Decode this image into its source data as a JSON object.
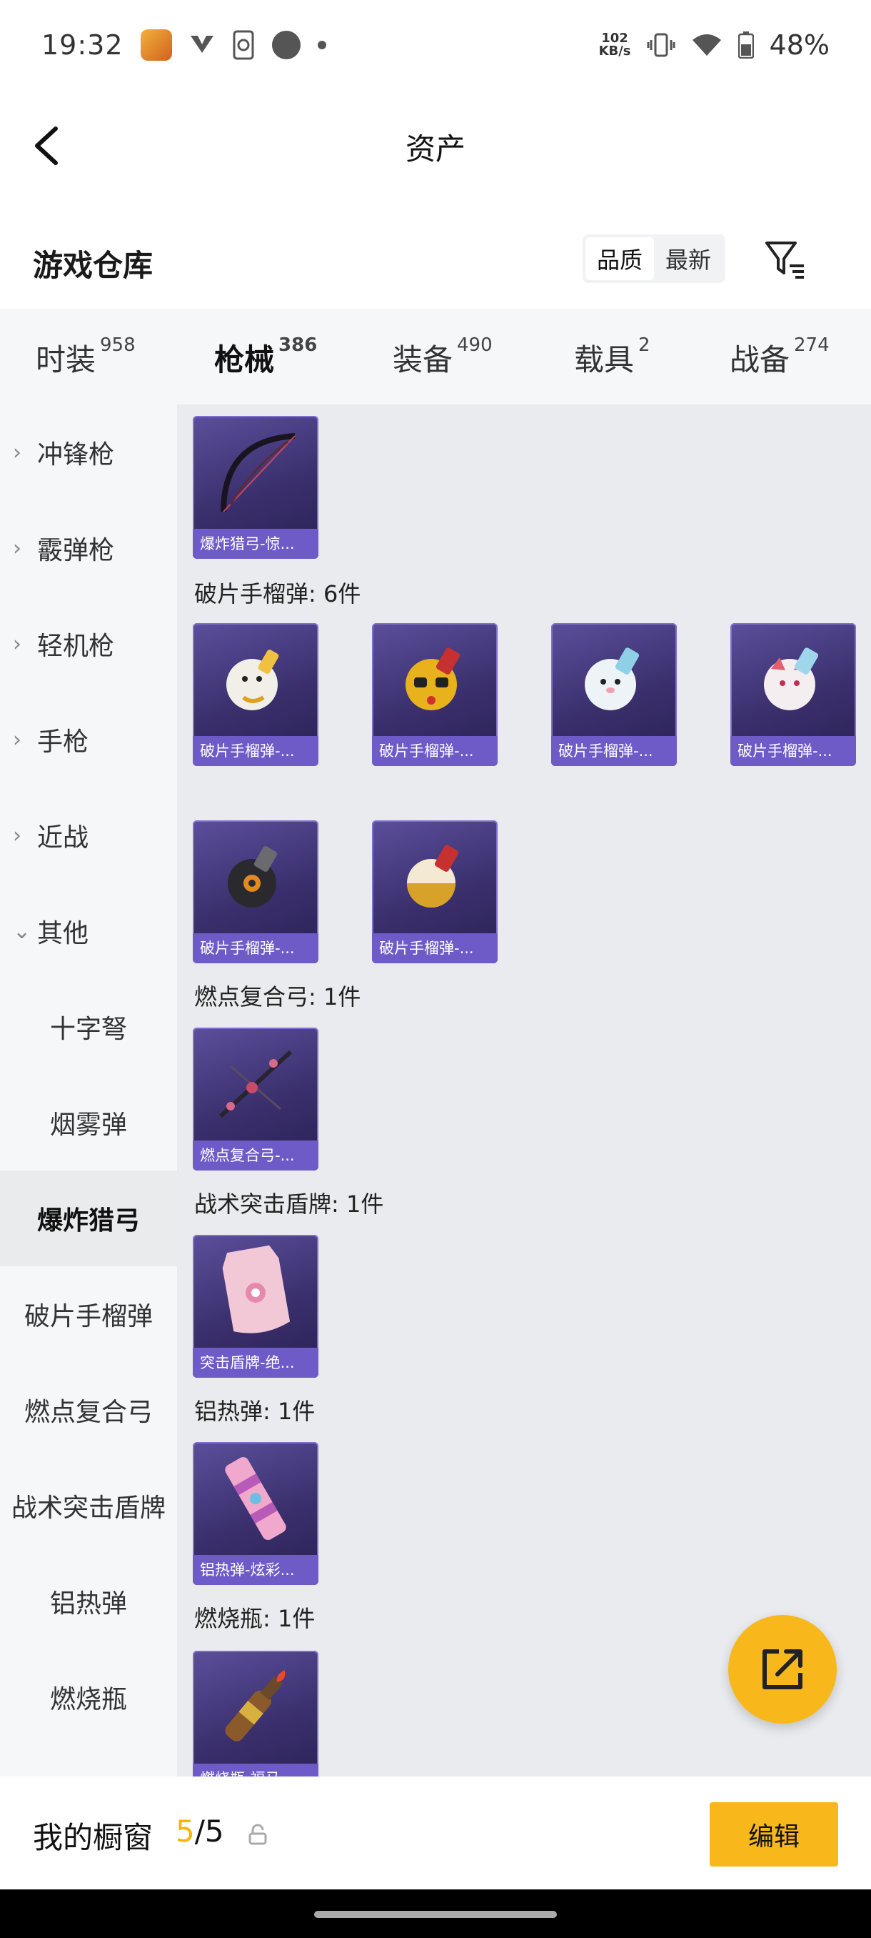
{
  "status_bar": {
    "time": "19:32",
    "net_speed_value": "102",
    "net_speed_unit": "KB/s",
    "battery": "48%",
    "icons": [
      "app-icon",
      "logo-icon",
      "sync-icon",
      "record-dot-icon",
      "dot-icon",
      "vibrate-icon",
      "wifi-icon",
      "battery-icon"
    ]
  },
  "header": {
    "title": "资产"
  },
  "warehouse": {
    "title": "游戏仓库",
    "sort_options": [
      "品质",
      "最新"
    ],
    "sort_active_index": 0
  },
  "tabs": [
    {
      "label": "时装",
      "count": "958"
    },
    {
      "label": "枪械",
      "count": "386",
      "active": true
    },
    {
      "label": "装备",
      "count": "490"
    },
    {
      "label": "载具",
      "count": "2"
    },
    {
      "label": "战备",
      "count": "274"
    }
  ],
  "sidebar": [
    {
      "label": "冲锋枪",
      "expandable": true
    },
    {
      "label": "霰弹枪",
      "expandable": true
    },
    {
      "label": "轻机枪",
      "expandable": true
    },
    {
      "label": "手枪",
      "expandable": true
    },
    {
      "label": "近战",
      "expandable": true
    },
    {
      "label": "其他",
      "expanded": true
    },
    {
      "label": "十字弩"
    },
    {
      "label": "烟雾弹"
    },
    {
      "label": "爆炸猎弓",
      "active": true
    },
    {
      "label": "破片手榴弹"
    },
    {
      "label": "燃点复合弓"
    },
    {
      "label": "战术突击盾牌"
    },
    {
      "label": "铝热弹"
    },
    {
      "label": "燃烧瓶"
    }
  ],
  "content": {
    "top_item": {
      "caption": "爆炸猎弓-惊...",
      "icon": "bow-icon"
    },
    "groups": [
      {
        "label": "破片手榴弹: 6件",
        "items": [
          {
            "caption": "破片手榴弹-...",
            "icon": "snowman-grenade-icon"
          },
          {
            "caption": "破片手榴弹-...",
            "icon": "face-grenade-icon"
          },
          {
            "caption": "破片手榴弹-...",
            "icon": "seal-grenade-icon"
          },
          {
            "caption": "破片手榴弹-...",
            "icon": "fox-grenade-icon"
          },
          {
            "caption": "破片手榴弹-...",
            "icon": "black-grenade-icon"
          },
          {
            "caption": "破片手榴弹-...",
            "icon": "gold-grenade-icon"
          }
        ]
      },
      {
        "label": "燃点复合弓: 1件",
        "items": [
          {
            "caption": "燃点复合弓-...",
            "icon": "compound-bow-icon"
          }
        ]
      },
      {
        "label": "战术突击盾牌: 1件",
        "items": [
          {
            "caption": "突击盾牌-绝...",
            "icon": "shield-icon"
          }
        ]
      },
      {
        "label": "铝热弹: 1件",
        "items": [
          {
            "caption": "铝热弹-炫彩...",
            "icon": "thermite-icon"
          }
        ]
      },
      {
        "label": "燃烧瓶: 1件",
        "items": [
          {
            "caption": "燃烧瓶-福马...",
            "icon": "molotov-icon"
          }
        ]
      }
    ]
  },
  "bottom_bar": {
    "label": "我的橱窗",
    "count_current": "5",
    "count_sep": "/",
    "count_total": "5",
    "edit_label": "编辑"
  },
  "colors": {
    "accent": "#f8b81c",
    "card": "#3a2f6c",
    "caption": "#6e5bc8"
  }
}
